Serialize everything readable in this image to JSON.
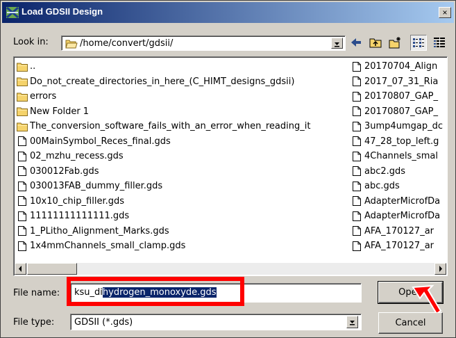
{
  "window": {
    "title": "Load GDSII Design",
    "close_label": "×"
  },
  "look_in": {
    "label": "Look in:",
    "path": "/home/convert/gdsii/"
  },
  "toolbar": {
    "icons": [
      "back-arrow-icon",
      "up-folder-icon",
      "new-folder-icon",
      "list-view-icon",
      "details-view-icon"
    ]
  },
  "files": {
    "left": [
      {
        "name": "..",
        "type": "folder"
      },
      {
        "name": "Do_not_create_directories_in_here_(C_HIMT_designs_gdsii)",
        "type": "folder"
      },
      {
        "name": "errors",
        "type": "folder"
      },
      {
        "name": "New Folder 1",
        "type": "folder"
      },
      {
        "name": "The_conversion_software_fails_with_an_error_when_reading_it",
        "type": "folder"
      },
      {
        "name": "00MainSymbol_Reces_final.gds",
        "type": "file"
      },
      {
        "name": "02_mzhu_recess.gds",
        "type": "file"
      },
      {
        "name": "030012Fab.gds",
        "type": "file"
      },
      {
        "name": "030013FAB_dummy_filler.gds",
        "type": "file"
      },
      {
        "name": "10x10_chip_filler.gds",
        "type": "file"
      },
      {
        "name": "11111111111111.gds",
        "type": "file"
      },
      {
        "name": "1_PLitho_Alignment_Marks.gds",
        "type": "file"
      },
      {
        "name": "1x4mmChannels_small_clamp.gds",
        "type": "file"
      }
    ],
    "right": [
      {
        "name": "20170704_Align",
        "type": "file"
      },
      {
        "name": "2017_07_31_Ria",
        "type": "file"
      },
      {
        "name": "20170807_GAP_",
        "type": "file"
      },
      {
        "name": "20170807_GAP_",
        "type": "file"
      },
      {
        "name": "3ump4umgap_dc",
        "type": "file"
      },
      {
        "name": "47_28_top_left.g",
        "type": "file"
      },
      {
        "name": "4Channels_smal",
        "type": "file"
      },
      {
        "name": "abc2.gds",
        "type": "file"
      },
      {
        "name": "abc.gds",
        "type": "file"
      },
      {
        "name": "AdapterMicrofDa",
        "type": "file"
      },
      {
        "name": "AdapterMicrofDa",
        "type": "file"
      },
      {
        "name": "AFA_170127_ar",
        "type": "file"
      },
      {
        "name": "AFA_170127_ar",
        "type": "file"
      }
    ]
  },
  "file_name": {
    "label": "File name:",
    "value_plain": "ksu_di",
    "value_selected": "hydrogen_monoxyde.gds"
  },
  "file_type": {
    "label": "File type:",
    "value": "GDSII (*.gds)"
  },
  "buttons": {
    "open": "Open",
    "cancel": "Cancel"
  },
  "colors": {
    "selection": "#0a246a",
    "highlight": "#ff0000",
    "titlebar_start": "#0a246a"
  }
}
